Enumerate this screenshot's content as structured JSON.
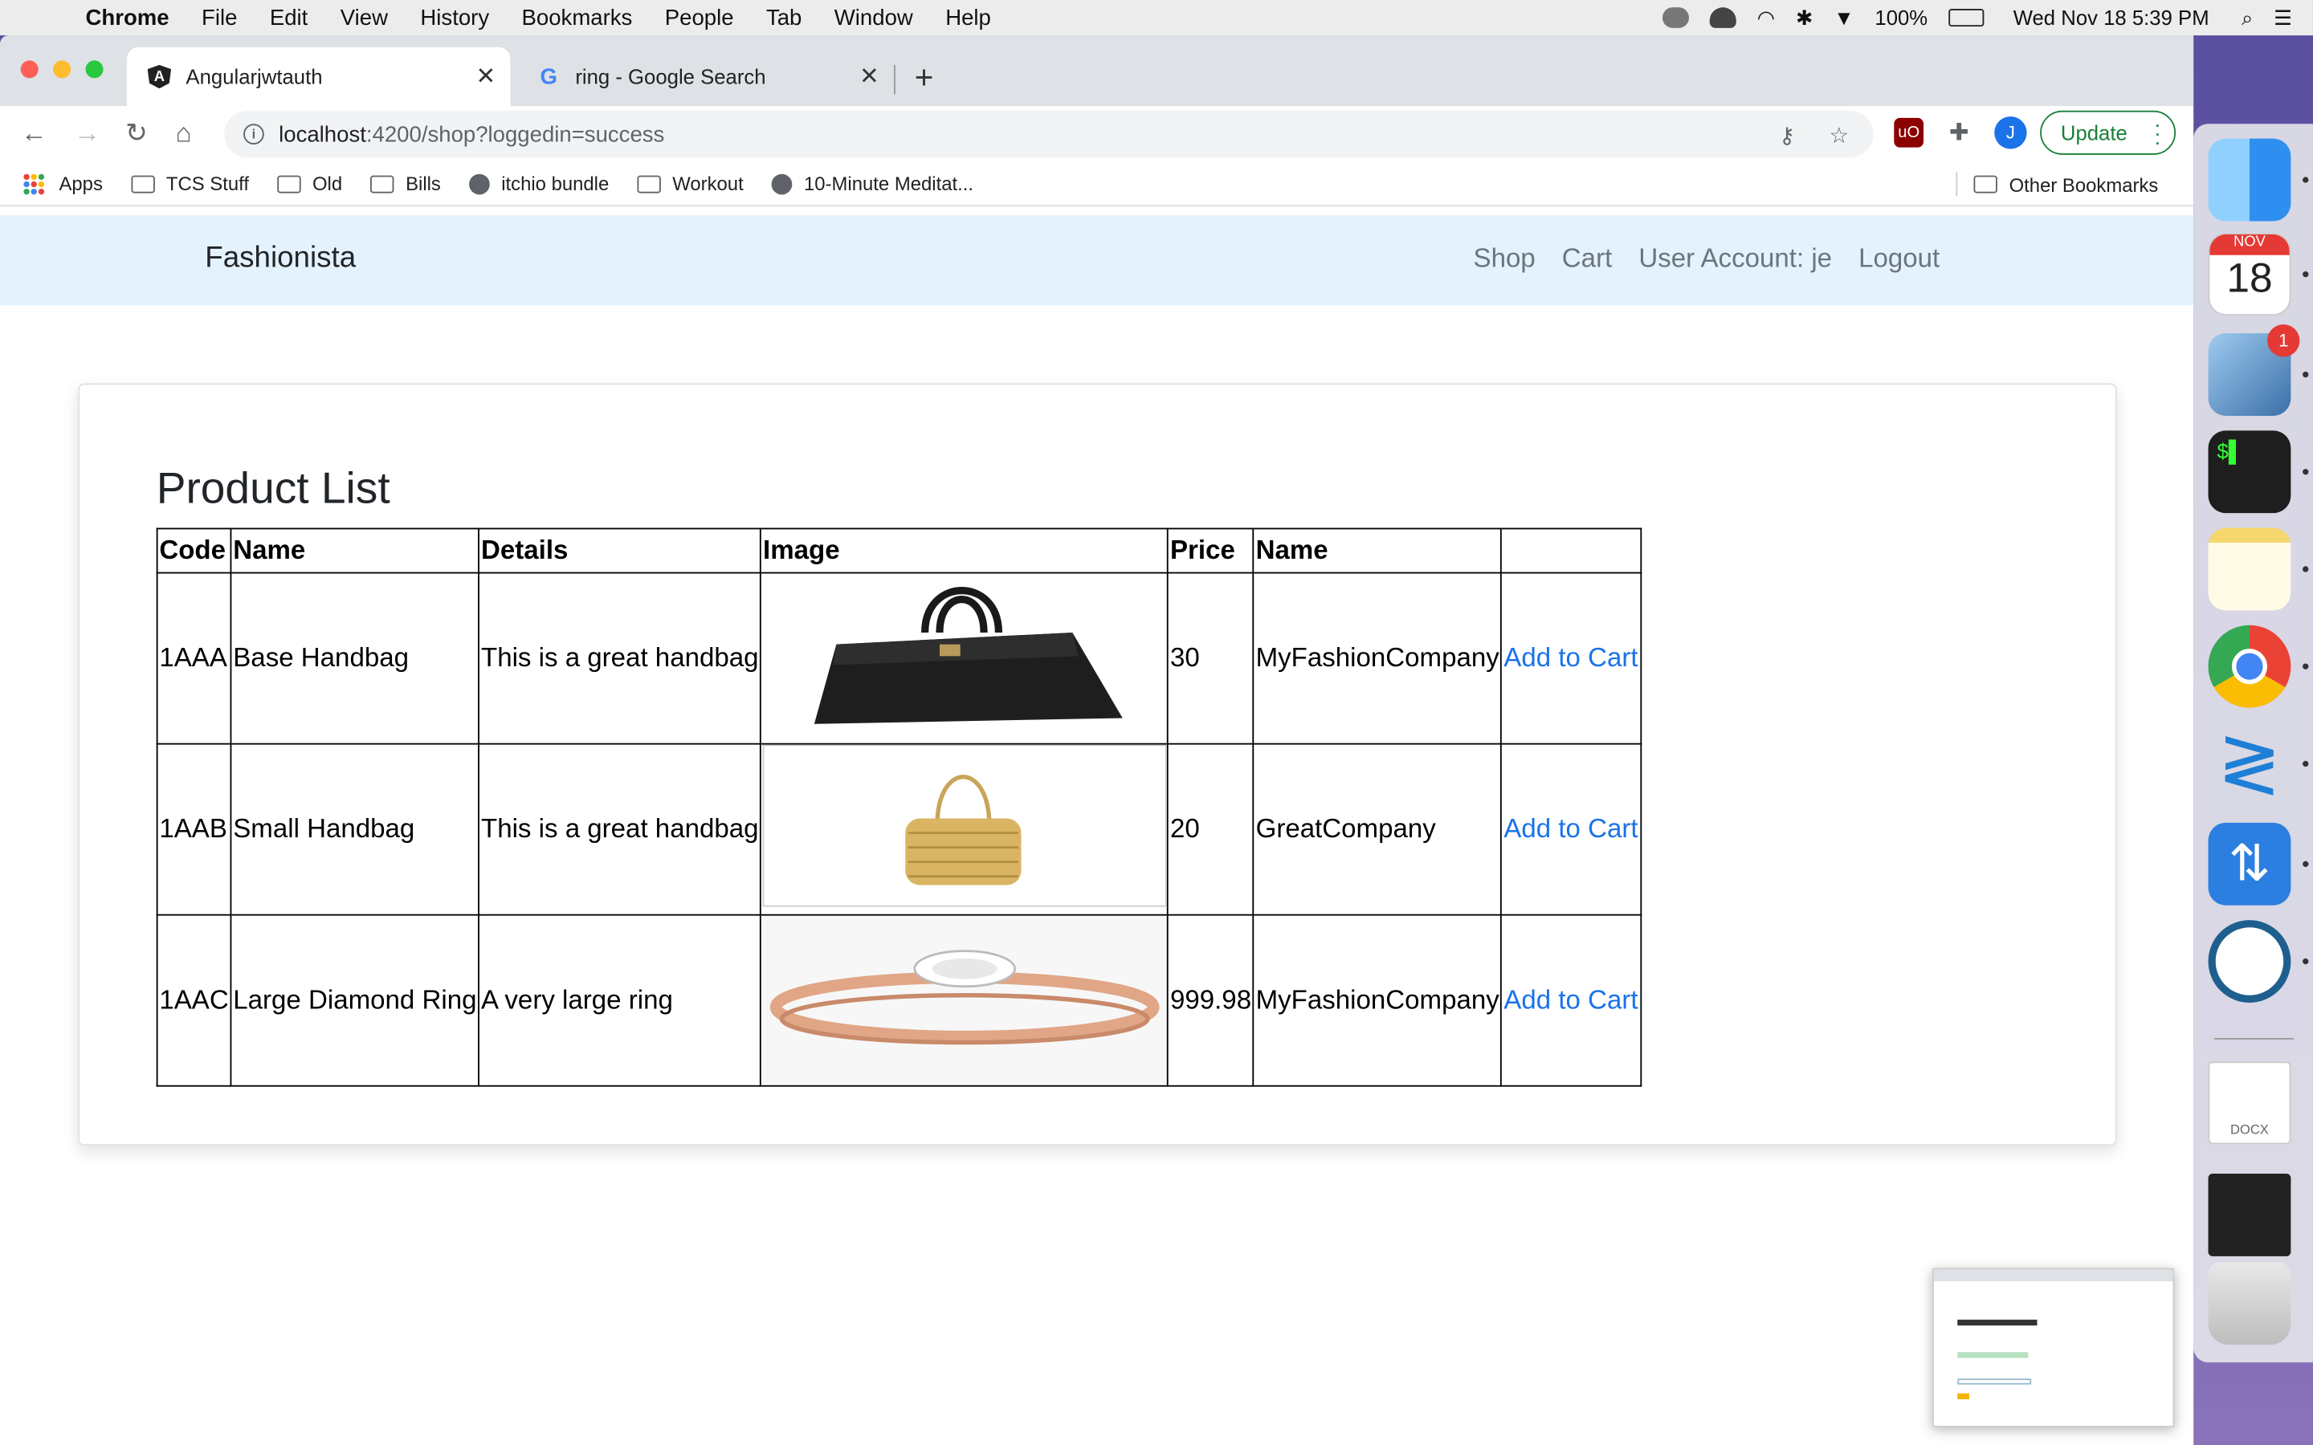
{
  "menubar": {
    "app_name": "Chrome",
    "items": [
      "File",
      "Edit",
      "View",
      "History",
      "Bookmarks",
      "People",
      "Tab",
      "Window",
      "Help"
    ],
    "battery": "100%",
    "datetime": "Wed Nov 18  5:39 PM"
  },
  "browser": {
    "tabs": [
      {
        "title": "Angularjwtauth"
      },
      {
        "title": "ring - Google Search"
      }
    ],
    "url_host": "localhost",
    "url_path": ":4200/shop?loggedin=success",
    "update_label": "Update",
    "avatar_letter": "J",
    "bookmarks": [
      "Apps",
      "TCS Stuff",
      "Old",
      "Bills",
      "itchio bundle",
      "Workout",
      "10-Minute Meditat..."
    ],
    "other_bookmarks": "Other Bookmarks"
  },
  "site": {
    "brand": "Fashionista",
    "nav": [
      "Shop",
      "Cart",
      "User Account: je",
      "Logout"
    ]
  },
  "product_list": {
    "title": "Product List",
    "headers": [
      "Code",
      "Name",
      "Details",
      "Image",
      "Price",
      "Name",
      ""
    ],
    "rows": [
      {
        "code": "1AAA",
        "name": "Base Handbag",
        "details": "This is a great handbag",
        "image": "black-handbag-image",
        "price": "30",
        "company": "MyFashionCompany",
        "action": "Add to Cart"
      },
      {
        "code": "1AAB",
        "name": "Small Handbag",
        "details": "This is a great handbag",
        "image": "gold-woven-handbag-image",
        "price": "20",
        "company": "GreatCompany",
        "action": "Add to Cart"
      },
      {
        "code": "1AAC",
        "name": "Large Diamond Ring",
        "details": "A very large ring",
        "image": "rose-gold-diamond-ring-image",
        "price": "999.98",
        "company": "MyFashionCompany",
        "action": "Add to Cart"
      }
    ]
  },
  "dock": {
    "calendar_month": "NOV",
    "calendar_day": "18",
    "mail_badge": "1",
    "doc_label": "DOCX"
  },
  "colors": {
    "navbar_bg": "#e3f2fd",
    "link": "#1a73e8",
    "update_green": "#188038"
  }
}
